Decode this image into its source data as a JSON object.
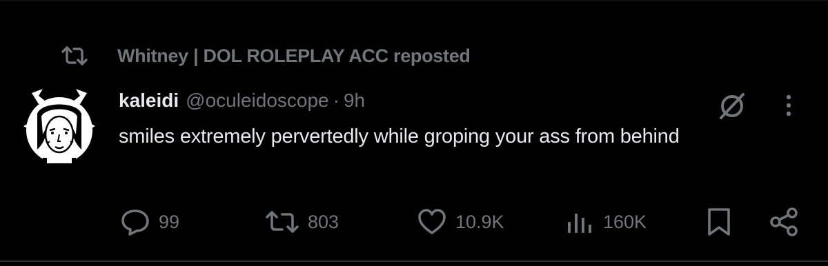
{
  "repost": {
    "icon": "repost-icon",
    "text": "Whitney | DOL ROLEPLAY ACC reposted"
  },
  "post": {
    "avatar": "avatar-drawing",
    "display_name": "kaleidi",
    "handle": "@oculeidoscope",
    "separator": "·",
    "time": "9h",
    "text": "smiles extremely pervertedly while groping your ass from behind",
    "header_icons": [
      "grok-icon",
      "more-icon"
    ]
  },
  "actions": {
    "replies": {
      "icon": "reply-icon",
      "count": "99"
    },
    "reposts": {
      "icon": "repost-icon",
      "count": "803"
    },
    "likes": {
      "icon": "like-icon",
      "count": "10.9K"
    },
    "views": {
      "icon": "views-icon",
      "count": "160K"
    },
    "bookmark": {
      "icon": "bookmark-icon"
    },
    "share": {
      "icon": "share-icon"
    }
  },
  "colors": {
    "background": "#000000",
    "primary_text": "#e7e9ea",
    "secondary_text": "#71767b",
    "divider": "#2f3336"
  }
}
